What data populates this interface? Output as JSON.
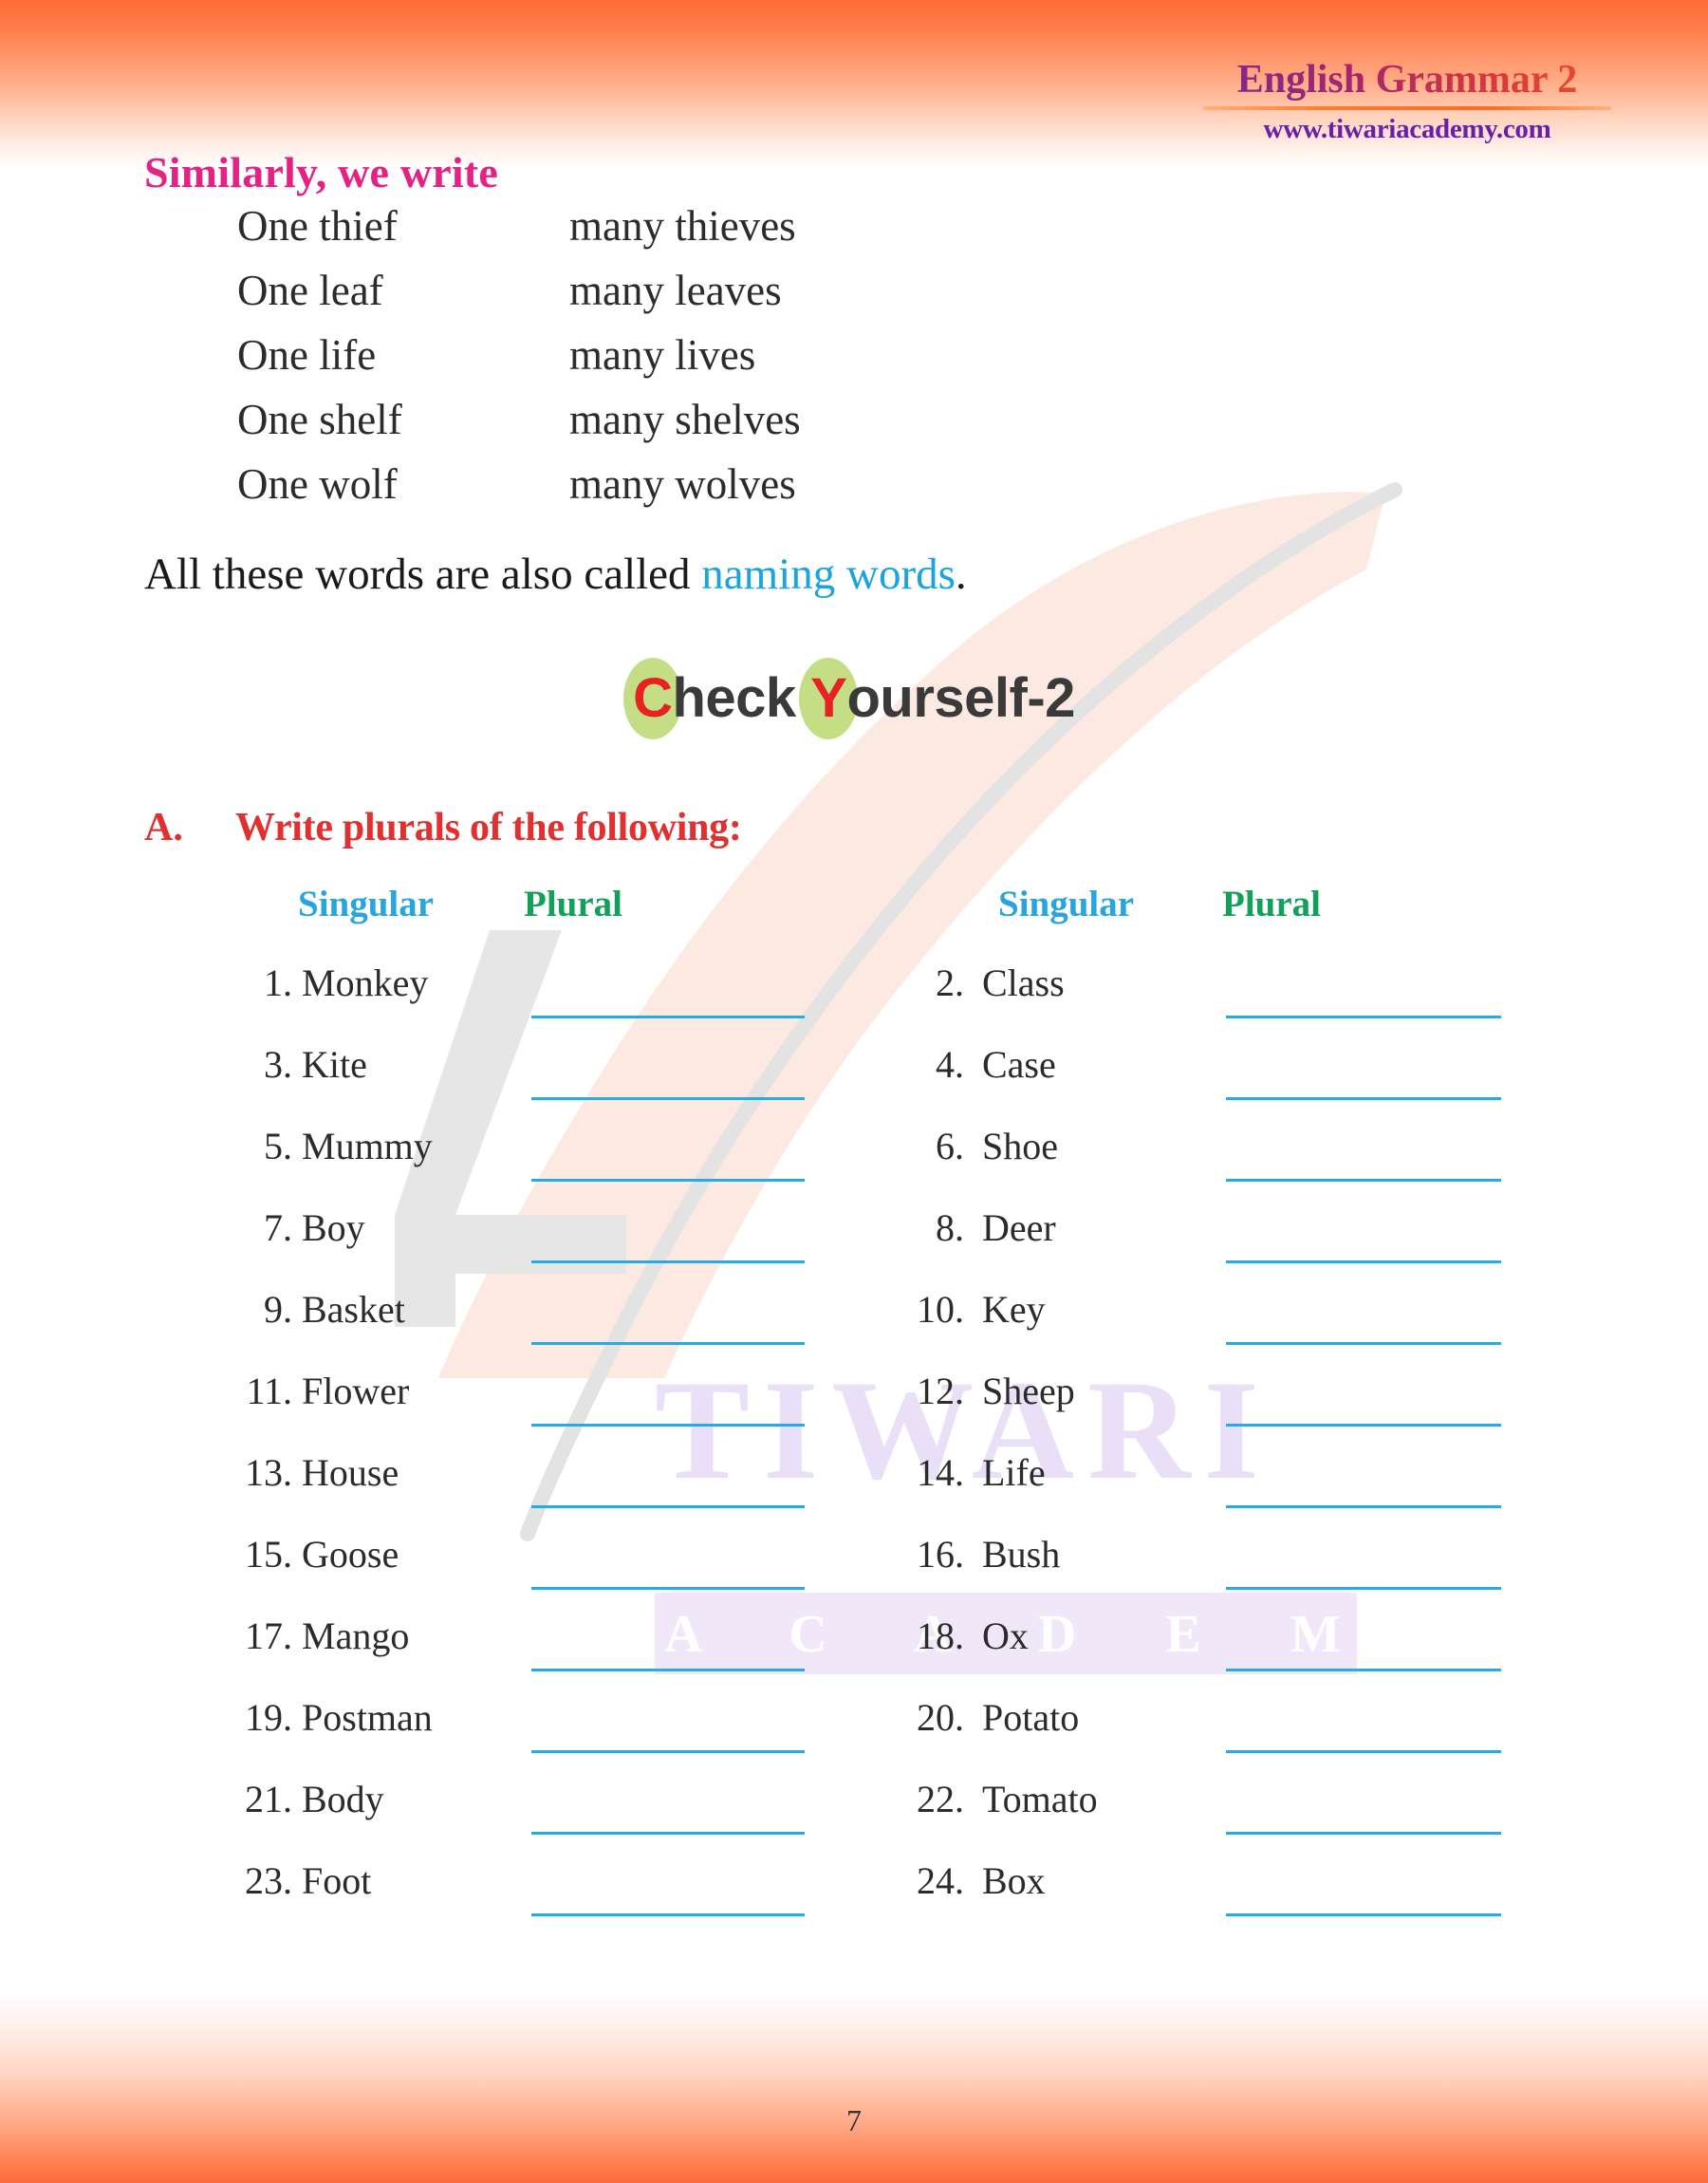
{
  "header": {
    "brand_title": "English Grammar 2",
    "brand_url": "www.tiwariacademy.com"
  },
  "similarly": {
    "heading": "Similarly, we write",
    "pairs": [
      {
        "singular": "One thief",
        "plural": "many thieves"
      },
      {
        "singular": "One leaf",
        "plural": "many leaves"
      },
      {
        "singular": "One life",
        "plural": "many lives"
      },
      {
        "singular": "One shelf",
        "plural": "many shelves"
      },
      {
        "singular": "One wolf",
        "plural": "many wolves"
      }
    ]
  },
  "naming": {
    "prefix": "All these words are also called ",
    "highlight": "naming words",
    "suffix": "."
  },
  "check_yourself": {
    "cap_c": "C",
    "rest_check": "heck",
    "cap_y": "Y",
    "rest_yourself": "ourself-2"
  },
  "section": {
    "label": "A.",
    "title": "Write plurals of the following:",
    "columns": {
      "singular": "Singular",
      "plural": "Plural"
    }
  },
  "exercise": {
    "rows": [
      {
        "left": {
          "num": "1.",
          "word": "Monkey",
          "answer": ""
        },
        "right": {
          "num": "2.",
          "word": "Class",
          "answer": ""
        }
      },
      {
        "left": {
          "num": "3.",
          "word": "Kite",
          "answer": ""
        },
        "right": {
          "num": "4.",
          "word": "Case",
          "answer": ""
        }
      },
      {
        "left": {
          "num": "5.",
          "word": "Mummy",
          "answer": ""
        },
        "right": {
          "num": "6.",
          "word": "Shoe",
          "answer": ""
        }
      },
      {
        "left": {
          "num": "7.",
          "word": "Boy",
          "answer": ""
        },
        "right": {
          "num": "8.",
          "word": "Deer",
          "answer": ""
        }
      },
      {
        "left": {
          "num": "9.",
          "word": "Basket",
          "answer": ""
        },
        "right": {
          "num": "10.",
          "word": "Key",
          "answer": ""
        }
      },
      {
        "left": {
          "num": "11.",
          "word": "Flower",
          "answer": ""
        },
        "right": {
          "num": "12.",
          "word": "Sheep",
          "answer": ""
        }
      },
      {
        "left": {
          "num": "13.",
          "word": "House",
          "answer": ""
        },
        "right": {
          "num": "14.",
          "word": "Life",
          "answer": ""
        }
      },
      {
        "left": {
          "num": "15.",
          "word": "Goose",
          "answer": ""
        },
        "right": {
          "num": "16.",
          "word": "Bush",
          "answer": ""
        }
      },
      {
        "left": {
          "num": "17.",
          "word": "Mango",
          "answer": ""
        },
        "right": {
          "num": "18.",
          "word": "Ox",
          "answer": ""
        }
      },
      {
        "left": {
          "num": "19.",
          "word": "Postman",
          "answer": ""
        },
        "right": {
          "num": "20.",
          "word": "Potato",
          "answer": ""
        }
      },
      {
        "left": {
          "num": "21.",
          "word": "Body",
          "answer": ""
        },
        "right": {
          "num": "22.",
          "word": "Tomato",
          "answer": ""
        }
      },
      {
        "left": {
          "num": "23.",
          "word": "Foot",
          "answer": ""
        },
        "right": {
          "num": "24.",
          "word": "Box",
          "answer": ""
        }
      }
    ]
  },
  "watermark": {
    "tiwari": "TIWARI",
    "academy": "A C A D E M Y"
  },
  "footer": {
    "page_number": "7"
  },
  "colors": {
    "band_orange": "#ff6b35",
    "heading_pink": "#e32283",
    "section_red": "#e03030",
    "singular_blue": "#29a5dd",
    "plural_green": "#13a05a",
    "answer_line": "#27abe2",
    "naming_blue": "#1aa3e0",
    "cap_ellipse_green": "#c5dd84",
    "cap_letter_red": "#e62222",
    "brand_purple": "#6a1fa8",
    "watermark_purple": "#e9dff6"
  }
}
